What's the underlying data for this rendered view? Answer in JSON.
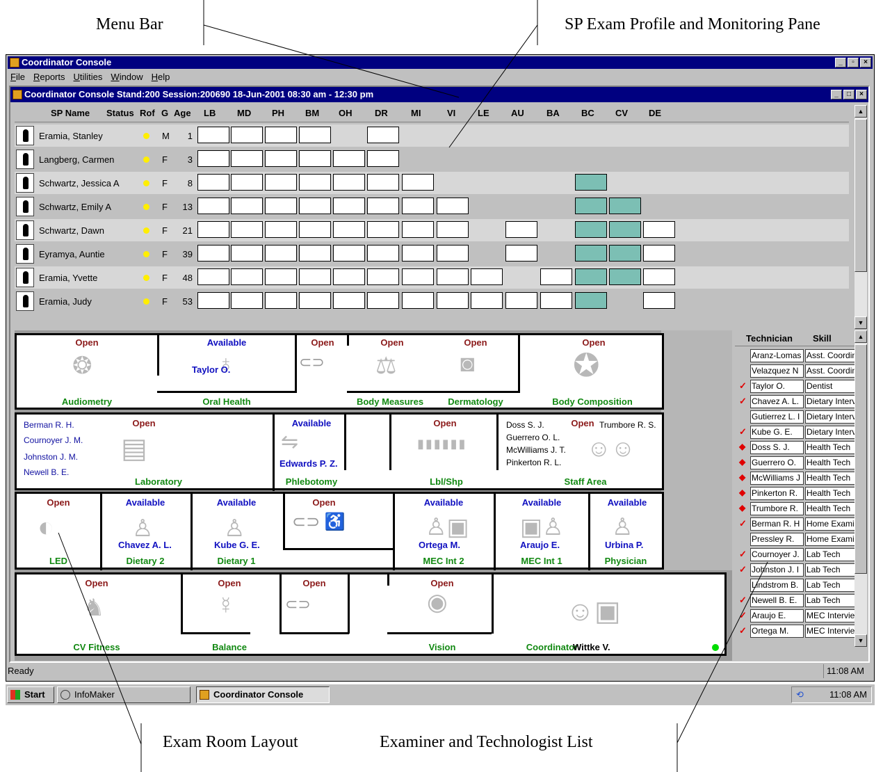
{
  "annotations": {
    "menu_bar": "Menu Bar",
    "profile_pane": "SP Exam Profile and Monitoring Pane",
    "room_layout": "Exam Room Layout",
    "examiner_list": "Examiner and Technologist List"
  },
  "window": {
    "title": "Coordinator Console",
    "menus": [
      "File",
      "Reports",
      "Utilities",
      "Window",
      "Help"
    ],
    "inner_title": "Coordinator Console Stand:200 Session:200690 18-Jun-2001 08:30 am - 12:30 pm"
  },
  "grid": {
    "columns": [
      "SP Name",
      "Status",
      "Rof",
      "G",
      "Age",
      "LB",
      "MD",
      "PH",
      "BM",
      "OH",
      "DR",
      "MI",
      "VI",
      "LE",
      "AU",
      "BA",
      "BC",
      "CV",
      "DE"
    ],
    "status_color": "#ffee00",
    "complete_color": "#7cbfb4",
    "rows": [
      {
        "name": "Eramia, Stanley",
        "g": "M",
        "age": "1"
      },
      {
        "name": "Langberg, Carmen",
        "g": "F",
        "age": "3"
      },
      {
        "name": "Schwartz, Jessica A",
        "g": "F",
        "age": "8"
      },
      {
        "name": "Schwartz, Emily A",
        "g": "F",
        "age": "13"
      },
      {
        "name": "Schwartz, Dawn",
        "g": "F",
        "age": "21"
      },
      {
        "name": "Eyramya, Auntie",
        "g": "F",
        "age": "39"
      },
      {
        "name": "Eramia, Yvette",
        "g": "F",
        "age": "48"
      },
      {
        "name": "Eramia, Judy",
        "g": "F",
        "age": "53"
      }
    ]
  },
  "rooms": {
    "audiometry": {
      "status": "Open",
      "name": "Audiometry"
    },
    "oral_health": {
      "status": "Available",
      "name": "Oral Health",
      "examiner": "Taylor O."
    },
    "body_measures": {
      "status": "Open",
      "name": "Body Measures"
    },
    "dermatology": {
      "status": "Open",
      "name": "Dermatology"
    },
    "body_composition": {
      "status": "Open",
      "name": "Body Composition"
    },
    "laboratory": {
      "status": "Open",
      "name": "Laboratory",
      "staff": [
        "Berman R. H.",
        "Cournoyer J. M.",
        "Johnston J. M.",
        "Newell B. E."
      ]
    },
    "phlebotomy": {
      "status": "Available",
      "name": "Phlebotomy",
      "examiner": "Edwards P. Z."
    },
    "lbl_shp": {
      "status": "Open",
      "name": "Lbl/Shp"
    },
    "staff_area": {
      "status": "Open",
      "name": "Staff Area",
      "first": "Trumbore R. S.",
      "staff": [
        "Doss S. J.",
        "Guerrero O. L.",
        "McWilliams J. T.",
        "Pinkerton R. L."
      ]
    },
    "led": {
      "status": "Open",
      "name": "LED"
    },
    "dietary2": {
      "status": "Available",
      "name": "Dietary 2",
      "examiner": "Chavez A. L."
    },
    "dietary1": {
      "status": "Available",
      "name": "Dietary 1",
      "examiner": "Kube G. E."
    },
    "mid3": {
      "status": "Open"
    },
    "mec2": {
      "status": "Available",
      "name": "MEC Int 2",
      "examiner": "Ortega M."
    },
    "mec1": {
      "status": "Available",
      "name": "MEC Int 1",
      "examiner": "Araujo E."
    },
    "physician": {
      "status": "Available",
      "name": "Physician",
      "examiner": "Urbina P."
    },
    "cv_fitness": {
      "status": "Open",
      "name": "CV Fitness"
    },
    "balance": {
      "status": "Open",
      "name": "Balance"
    },
    "mid4": {
      "status": "Open"
    },
    "vision": {
      "status": "Open",
      "name": "Vision"
    },
    "coordinator": {
      "name": "Coordinator",
      "examiner": "Wittke V."
    }
  },
  "tech_list": {
    "headers": {
      "technician": "Technician",
      "skill": "Skill"
    },
    "rows": [
      {
        "mark": "",
        "tech": "Aranz-Lomas",
        "skill": "Asst. Coordinator"
      },
      {
        "mark": "",
        "tech": "Velazquez N",
        "skill": "Asst. Coordinator"
      },
      {
        "mark": "check",
        "tech": "Taylor O.",
        "skill": "Dentist"
      },
      {
        "mark": "check",
        "tech": "Chavez A. L.",
        "skill": "Dietary Interviewer"
      },
      {
        "mark": "",
        "tech": "Gutierrez L. I",
        "skill": "Dietary Interviewer"
      },
      {
        "mark": "check",
        "tech": "Kube G. E.",
        "skill": "Dietary Interviewer"
      },
      {
        "mark": "diamond",
        "tech": "Doss S. J.",
        "skill": "Health Tech"
      },
      {
        "mark": "diamond",
        "tech": "Guerrero O.",
        "skill": "Health Tech"
      },
      {
        "mark": "diamond",
        "tech": "McWilliams J",
        "skill": "Health Tech"
      },
      {
        "mark": "diamond",
        "tech": "Pinkerton R.",
        "skill": "Health Tech"
      },
      {
        "mark": "diamond",
        "tech": "Trumbore R.",
        "skill": "Health Tech"
      },
      {
        "mark": "check",
        "tech": "Berman R. H",
        "skill": "Home Examiner"
      },
      {
        "mark": "",
        "tech": "Pressley R.",
        "skill": "Home Examiner"
      },
      {
        "mark": "check",
        "tech": "Cournoyer J.",
        "skill": "Lab Tech"
      },
      {
        "mark": "check",
        "tech": "Johnston J. I",
        "skill": "Lab Tech"
      },
      {
        "mark": "",
        "tech": "Lindstrom B.",
        "skill": "Lab Tech"
      },
      {
        "mark": "check",
        "tech": "Newell B. E.",
        "skill": "Lab Tech"
      },
      {
        "mark": "check",
        "tech": "Araujo E.",
        "skill": "MEC Interviewer"
      },
      {
        "mark": "check",
        "tech": "Ortega M.",
        "skill": "MEC Interviewer"
      }
    ]
  },
  "status_bar": {
    "text": "Ready",
    "time": "11:08 AM"
  },
  "taskbar": {
    "start": "Start",
    "task1": "InfoMaker",
    "task2": "Coordinator Console",
    "clock": "11:08 AM"
  }
}
